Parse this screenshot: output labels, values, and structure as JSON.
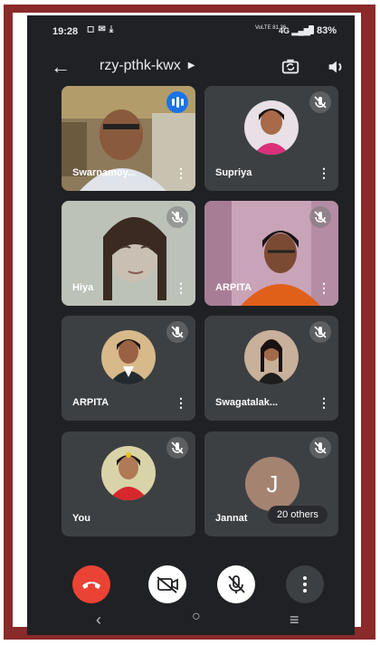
{
  "status_bar": {
    "time": "19:28",
    "network_text": "VoLTE 81.36",
    "signal_text": "4G",
    "battery": "83%"
  },
  "meeting": {
    "code": "rzy-pthk-kwx"
  },
  "participants": [
    {
      "name": "Swarnamoy...",
      "state": "speaking",
      "view": "camera"
    },
    {
      "name": "Supriya",
      "state": "muted",
      "view": "avatar"
    },
    {
      "name": "Hiya",
      "state": "muted",
      "view": "camera"
    },
    {
      "name": "ARPITA",
      "state": "muted",
      "view": "camera"
    },
    {
      "name": "ARPITA",
      "state": "muted",
      "view": "avatar"
    },
    {
      "name": "Swagatalak...",
      "state": "muted",
      "view": "avatar"
    },
    {
      "name": "You",
      "state": "muted",
      "view": "avatar"
    },
    {
      "name": "Jannat",
      "state": "muted",
      "view": "letter",
      "avatar_letter": "J"
    }
  ],
  "others_chip": "20 others",
  "controls": {
    "end_call": "end-call-icon",
    "camera": "camera-off-icon",
    "mic": "mic-off-icon",
    "more": "more-vert-icon"
  },
  "colors": {
    "background": "#202124",
    "tile": "#3c4043",
    "end_call": "#ea4335",
    "frame": "#8a2a2a",
    "speaking_badge": "#1a73e8"
  }
}
